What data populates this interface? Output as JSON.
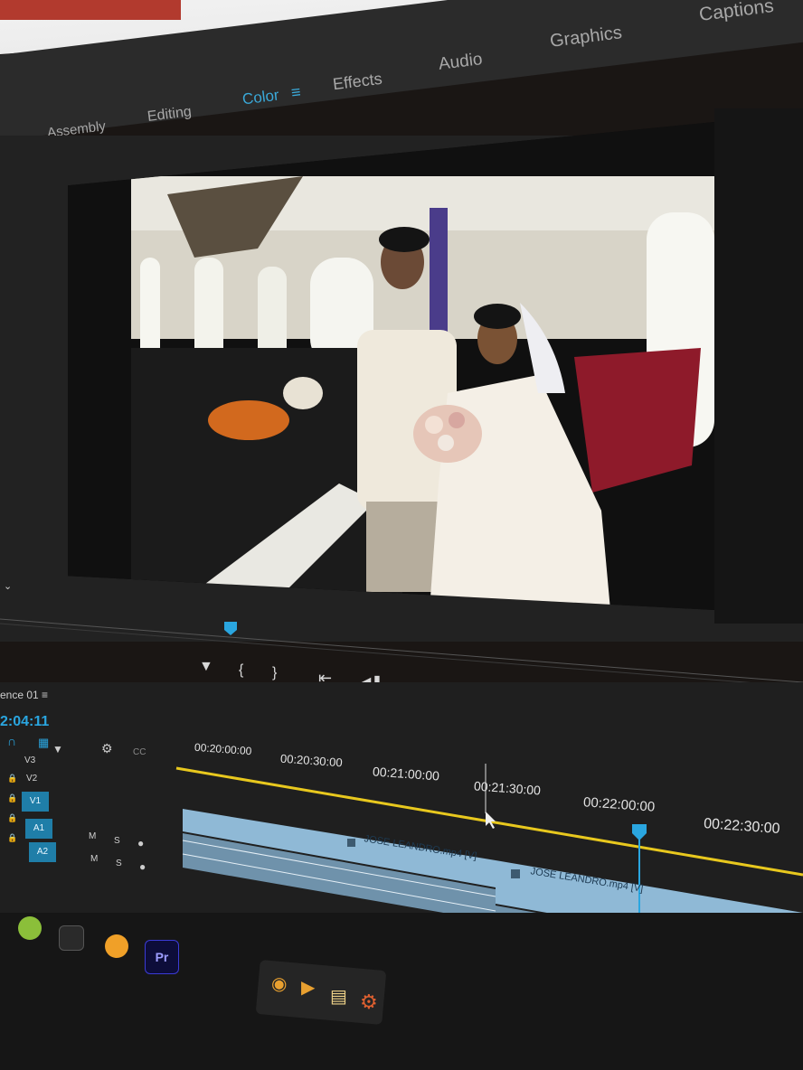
{
  "workspace": {
    "tabs": [
      "Assembly",
      "Editing",
      "Color",
      "Effects",
      "Audio",
      "Graphics",
      "Captions"
    ],
    "active_tab": "Color"
  },
  "sequence": {
    "name": "ence 01",
    "timecode": "2:04:11"
  },
  "timeline": {
    "ruler_labels": [
      "00:20:00:00",
      "00:20:30:00",
      "00:21:00:00",
      "00:21:30:00",
      "00:22:00:00",
      "00:22:30:00"
    ],
    "tracks": [
      "V3",
      "V2",
      "V1",
      "A1",
      "A2"
    ],
    "track_buttons": {
      "mute": "M",
      "solo": "S"
    },
    "clips": [
      {
        "label": "JOSE LEANDRO.mp4 [V]"
      },
      {
        "label": "JOSE LEANDRO.mp4 [V]"
      }
    ]
  },
  "taskbar": {
    "premiere_label": "Pr"
  },
  "colors": {
    "accent": "#3aa9d9",
    "playhead": "#2aa6e0",
    "work_area": "#e8c81e",
    "clip": "#8fb9d6"
  },
  "icons": [
    "marker-icon",
    "in-point-icon",
    "out-point-icon",
    "go-to-in-icon",
    "step-back-icon",
    "stop-icon",
    "play-icon",
    "go-to-out-icon",
    "insert-icon",
    "overwrite-icon",
    "camera-icon",
    "compare-icon"
  ]
}
